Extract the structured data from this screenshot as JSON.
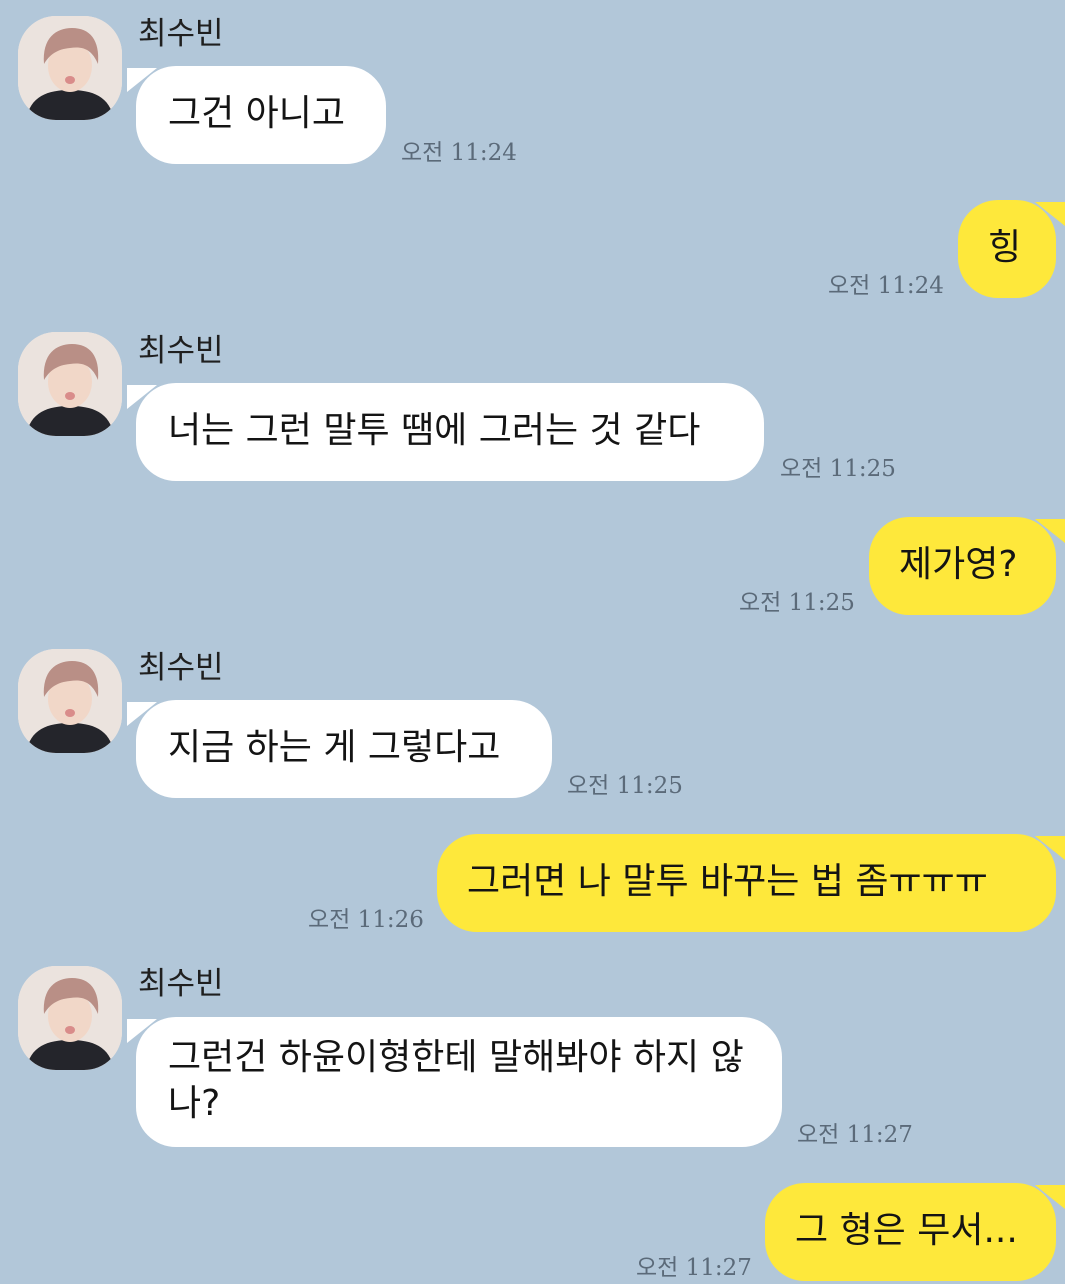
{
  "conversation": {
    "messages": [
      {
        "direction": "in",
        "sender": "최수빈",
        "text": "그건 아니고",
        "time": "오전 11:24"
      },
      {
        "direction": "out",
        "text": "힝",
        "time": "오전 11:24"
      },
      {
        "direction": "in",
        "sender": "최수빈",
        "text": "너는 그런 말투 땜에 그러는 것 같다",
        "time": "오전 11:25"
      },
      {
        "direction": "out",
        "text": "제가영?",
        "time": "오전 11:25"
      },
      {
        "direction": "in",
        "sender": "최수빈",
        "text": "지금 하는 게 그렇다고",
        "time": "오전 11:25"
      },
      {
        "direction": "out",
        "text": "그러면 나 말투 바꾸는 법 좀ㅠㅠㅠ",
        "time": "오전 11:26"
      },
      {
        "direction": "in",
        "sender": "최수빈",
        "text": "그런건 하윤이형한테 말해봐야 하지 않나?",
        "time": "오전 11:27"
      },
      {
        "direction": "out",
        "text": "그 형은 무서...",
        "time": "오전 11:27"
      }
    ]
  },
  "theme": {
    "background": "#b2c7d9",
    "incoming_bubble": "#ffffff",
    "outgoing_bubble": "#fee83b",
    "timestamp": "#5b6a79"
  },
  "icons": {
    "avatar": "profile-photo-avatar"
  }
}
